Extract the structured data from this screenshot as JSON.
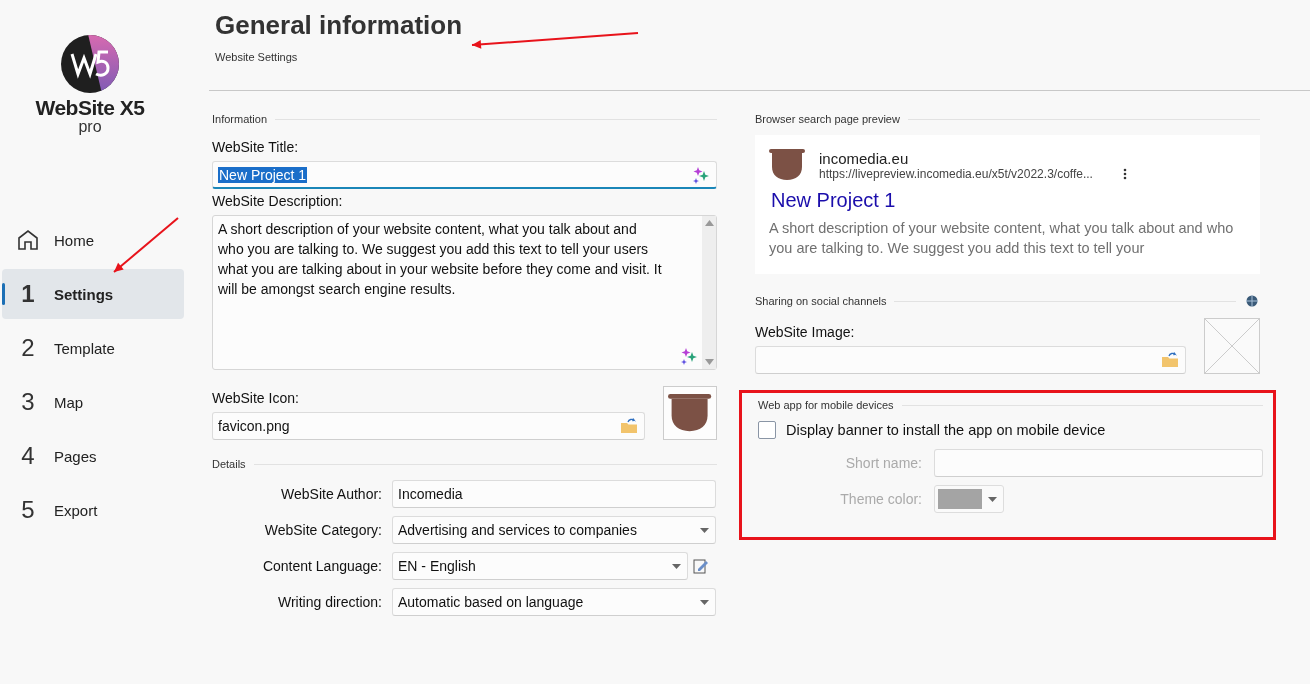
{
  "logo": {
    "name": "WebSite X5",
    "edition": "pro"
  },
  "nav": [
    {
      "label": "Home",
      "kind": "home",
      "selected": false
    },
    {
      "number": "1",
      "label": "Settings",
      "kind": "step",
      "selected": true
    },
    {
      "number": "2",
      "label": "Template",
      "kind": "step",
      "selected": false
    },
    {
      "number": "3",
      "label": "Map",
      "kind": "step",
      "selected": false
    },
    {
      "number": "4",
      "label": "Pages",
      "kind": "step",
      "selected": false
    },
    {
      "number": "5",
      "label": "Export",
      "kind": "step",
      "selected": false
    }
  ],
  "header": {
    "title": "General information",
    "subtitle": "Website Settings"
  },
  "information": {
    "section": "Information",
    "title_label": "WebSite Title:",
    "title_value": "New Project 1",
    "title_selected": true,
    "description_label": "WebSite Description:",
    "description_value": "A short description of your website content, what you talk about and who you are talking to. We suggest you add  this text to tell your users what you are talking about in your website before they come and visit. It will be amongst search engine results.",
    "icon_label": "WebSite Icon:",
    "icon_value": "favicon.png"
  },
  "details": {
    "section": "Details",
    "fields": [
      {
        "label": "WebSite Author:",
        "value": "Incomedia",
        "kind": "text"
      },
      {
        "label": "WebSite Category:",
        "value": "Advertising and services to companies",
        "kind": "dropdown"
      },
      {
        "label": "Content Language:",
        "value": "EN - English",
        "kind": "dropdown-edit"
      },
      {
        "label": "Writing direction:",
        "value": "Automatic based on language",
        "kind": "dropdown"
      }
    ]
  },
  "preview": {
    "section": "Browser search page preview",
    "site": "incomedia.eu",
    "url": "https://livepreview.incomedia.eu/x5t/v2022.3/coffe...",
    "title": "New Project 1",
    "snippet": "A short description of your website content, what you talk about and who you are talking to. We suggest you add  this text to tell your"
  },
  "sharing": {
    "section": "Sharing on social channels",
    "image_label": "WebSite Image:"
  },
  "webapp": {
    "section": "Web app for mobile devices",
    "highlighted": true,
    "checkbox_label": "Display banner to install the app on mobile device",
    "checked": false,
    "short_name_label": "Short name:",
    "theme_color_label": "Theme color:"
  },
  "annotations": [
    {
      "kind": "arrow"
    },
    {
      "kind": "arrow"
    }
  ]
}
